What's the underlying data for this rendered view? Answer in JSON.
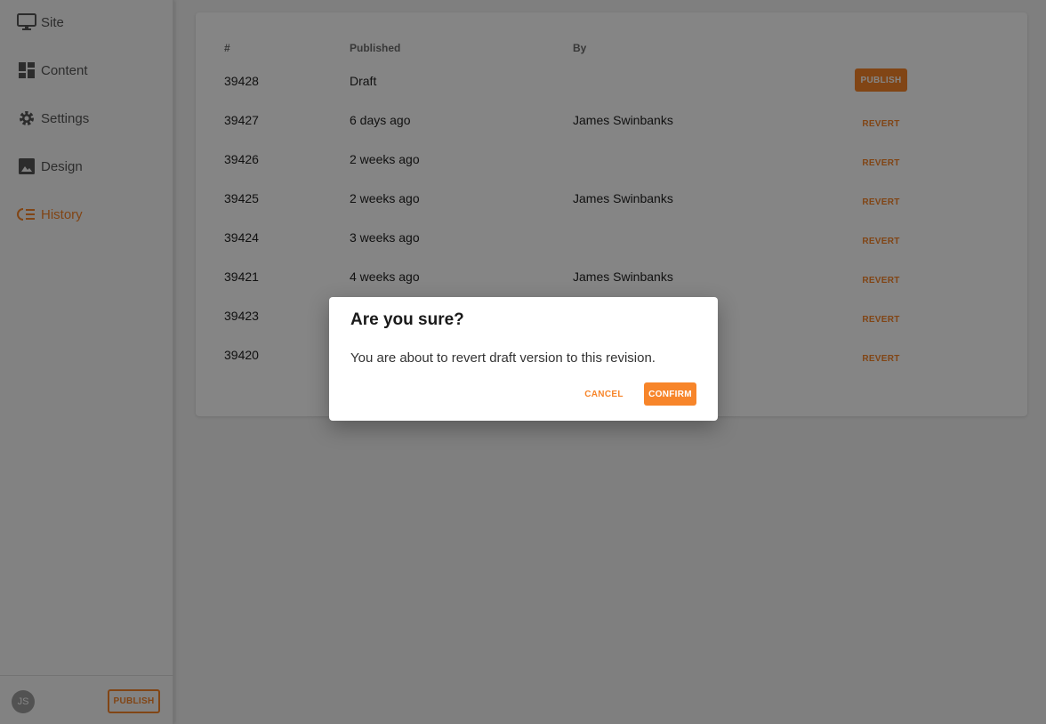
{
  "sidebar": {
    "items": [
      {
        "label": "Site",
        "icon": "monitor-icon"
      },
      {
        "label": "Content",
        "icon": "dashboard-icon"
      },
      {
        "label": "Settings",
        "icon": "gear-icon"
      },
      {
        "label": "Design",
        "icon": "image-icon"
      },
      {
        "label": "History",
        "icon": "history-icon",
        "active": true
      }
    ],
    "avatar_initials": "JS",
    "publish_label": "PUBLISH"
  },
  "table": {
    "headers": {
      "id": "#",
      "published": "Published",
      "by": "By"
    },
    "rows": [
      {
        "id": "39428",
        "published": "Draft",
        "by": "",
        "action": "PUBLISH"
      },
      {
        "id": "39427",
        "published": "6 days ago",
        "by": "James Swinbanks",
        "action": "REVERT"
      },
      {
        "id": "39426",
        "published": "2 weeks ago",
        "by": "",
        "action": "REVERT"
      },
      {
        "id": "39425",
        "published": "2 weeks ago",
        "by": "James Swinbanks",
        "action": "REVERT"
      },
      {
        "id": "39424",
        "published": "3 weeks ago",
        "by": "",
        "action": "REVERT"
      },
      {
        "id": "39421",
        "published": "4 weeks ago",
        "by": "James Swinbanks",
        "action": "REVERT"
      },
      {
        "id": "39423",
        "published": "",
        "by": "",
        "action": "REVERT"
      },
      {
        "id": "39420",
        "published": "",
        "by": "",
        "action": "REVERT"
      }
    ]
  },
  "dialog": {
    "title": "Are you sure?",
    "body": "You are about to revert draft version to this revision.",
    "cancel_label": "CANCEL",
    "confirm_label": "CONFIRM"
  },
  "colors": {
    "accent": "#f7852a"
  }
}
